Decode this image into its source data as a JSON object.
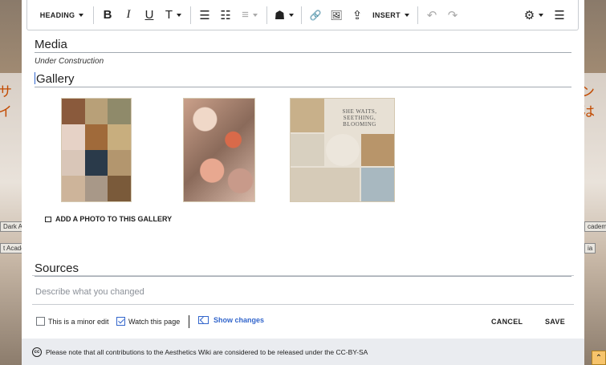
{
  "toolbar": {
    "heading_label": "HEADING",
    "insert_label": "INSERT",
    "icons": {
      "bold": "B",
      "italic": "I",
      "underline": "U",
      "text_style": "T",
      "bullet_list": "☰",
      "numbered_list": "☷",
      "align": "≡",
      "cite": "☗",
      "link": "🔗",
      "image": "🖼",
      "upload": "⇪",
      "undo": "↶",
      "redo": "↷",
      "settings": "⚙",
      "menu": "☰"
    }
  },
  "editor": {
    "media_heading": "Media",
    "under_construction": "Under Construction",
    "gallery_heading": "Gallery",
    "gallery_images": [
      {
        "name": "collage-1"
      },
      {
        "name": "collage-2"
      },
      {
        "name": "collage-3",
        "caption": "SHE WAITS, SEETHING, BLOOMING"
      }
    ],
    "add_photo_label": "ADD A PHOTO TO THIS GALLERY",
    "sources_heading": "Sources"
  },
  "save_panel": {
    "summary_placeholder": "Describe what you changed",
    "minor_edit_label": "This is a minor edit",
    "minor_edit_checked": false,
    "watch_label": "Watch this page",
    "watch_checked": true,
    "show_changes_label": "Show changes",
    "cancel_label": "CANCEL",
    "save_label": "SAVE"
  },
  "footer": {
    "cc_icon": "cc",
    "license_text": "Please note that all contributions to the Aesthetics Wiki are considered to be released under the CC-BY-SA"
  },
  "background": {
    "left_tab_top": "Dark A",
    "left_tab_bottom": "t Academ",
    "right_tab_top": "cademia",
    "right_tab_bottom": "ia",
    "left_jp": "サイ",
    "right_jp": "ンは"
  },
  "colors": {
    "accent": "#3366cc",
    "footer_bg": "#eaecf0",
    "border": "#c8ccd1"
  }
}
